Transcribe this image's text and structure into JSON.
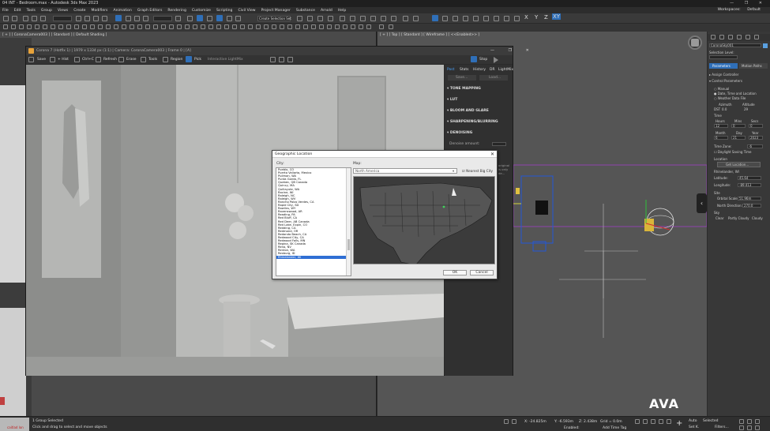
{
  "window": {
    "title": "04 INT - Bedroom.max - Autodesk 3ds Max 2023",
    "controls": "— ❐ ✕"
  },
  "menu": [
    "File",
    "Edit",
    "Tools",
    "Group",
    "Views",
    "Create",
    "Modifiers",
    "Animation",
    "Graph Editors",
    "Rendering",
    "Customize",
    "Scripting",
    "Civil View",
    "Project Manager",
    "Substance",
    "Arnold",
    "Help"
  ],
  "workspace": {
    "label": "Workspaces:",
    "value": "Default"
  },
  "toolbar": {
    "axes": [
      "X",
      "Y",
      "Z",
      "XY"
    ],
    "selection_set": "Create Selection Set"
  },
  "viewports": {
    "left_label": "[ + ] [ CoronaCamera003 ] [ Standard ] [ Default Shading ]",
    "right_label": "[ + ] [ Top ] [ Standard ] [ Wireframe ] [ <<Enabled>> ]"
  },
  "vfb": {
    "title": "Corona 7 (Hotfix 1) | 1979 x 1334 px (1:1) | Camera: CoronaCamera003 | Frame 0 | [A]",
    "toolbar": [
      "Save",
      "+ Hist",
      "Ctrl+C",
      "Refresh",
      "Erase",
      "Tools",
      "Region",
      "Pick",
      "Interactive LightMix"
    ],
    "stop_label": "Stop",
    "tabs": [
      "Post",
      "Stats",
      "History",
      "DR",
      "LightMix"
    ],
    "sub_tabs": [
      "Save...",
      "Load..."
    ],
    "sections": [
      "TONE MAPPING",
      "LUT",
      "BLOOM AND GLARE",
      "SHARPENING/BLURRING",
      "DENOISING"
    ],
    "denoise_label": "Denoise amount:",
    "denoise_value": "",
    "side_note": "original\nis only\nde..."
  },
  "geo_dialog": {
    "title": "Geographic Location",
    "city_label": "City:",
    "map_label": "Map:",
    "map_value": "North America",
    "nearest_label": "Nearest Big City",
    "ok": "OK",
    "cancel": "Cancel",
    "cities": [
      "Pueblo, CO",
      "Puerto Vallarta, Mexico",
      "Pullman, WA",
      "Punta Gorda, FL",
      "Quebec, QB Canada",
      "Quincy, MA",
      "Quillayute, WA",
      "Racine, WI",
      "Raleigh, NC",
      "Raleigh, WV",
      "Rancho Palos Verdes, CA",
      "Rapid City, SD",
      "Rawlins, WY",
      "Ravenswood, AR",
      "Reading, PA",
      "Red Bluff, CA",
      "Red Deer, AB Canada",
      "Red Lake, Expln, CO",
      "Redding, CA",
      "Redmond, OR",
      "Redondo Beach, CA",
      "Redwood City, CA",
      "Redwood Falls, MN",
      "Regina, SK Canada",
      "Reno, NV",
      "Renton, WA",
      "Rexburg, ID",
      "Rhinelander, WI"
    ],
    "selected_index": 27
  },
  "command_panel": {
    "object_name": "CoronaSky001",
    "selection_level": "Selection Level:",
    "tabs": [
      "Parameters",
      "Motion Paths"
    ],
    "assign_controller": "Assign Controller",
    "control_params": "Control Parameters",
    "radio": [
      "Manual",
      "Date, Time and Location",
      "Weather Data File"
    ],
    "azimuth": "Azimuth",
    "altitude": "Altitude",
    "az_val": "0.0",
    "alt_val": "29",
    "dst": "DST",
    "time": "Time",
    "hours": "Hours",
    "mins": "Mins",
    "secs": "Secs",
    "hours_val": "12",
    "mins_val": "0",
    "secs_val": "0",
    "month": "Month",
    "day": "Day",
    "year": "Year",
    "month_val": "6",
    "day_val": "21",
    "year_val": "2023",
    "time_zone": "Time Zone:",
    "tz_val": "-6",
    "dst_label": "Daylight Saving Time",
    "location": "Location",
    "get_location": "Get Location...",
    "location_name": "Rhinelander, WI",
    "latitude": "Latitude:",
    "longitude": "Longitude:",
    "lat_val": "45.64",
    "lon_val": "-89.413",
    "site": "Site",
    "orbital": "Orbital Scale:",
    "orbital_val": "51.96m",
    "north": "North Direction:",
    "north_val": "270.0",
    "sky": "Sky",
    "sky_opts": [
      "Clear",
      "Partly Cloudy",
      "Cloudy"
    ]
  },
  "status": {
    "selection": "1 Group Selected",
    "hint": "Click and drag to select and move objects",
    "maxscript": "caitlad lon",
    "x": "X: -24.825m",
    "y": "Y: -6.593m",
    "z": "Z: 2.438m",
    "grid": "Grid = 0.0m",
    "enabled": "Enabled:",
    "add_time_tag": "Add Time Tag",
    "auto": "Auto",
    "selected": "Selected",
    "set_key": "Set K.",
    "filters": "Filters..."
  },
  "watermark": "AVA"
}
